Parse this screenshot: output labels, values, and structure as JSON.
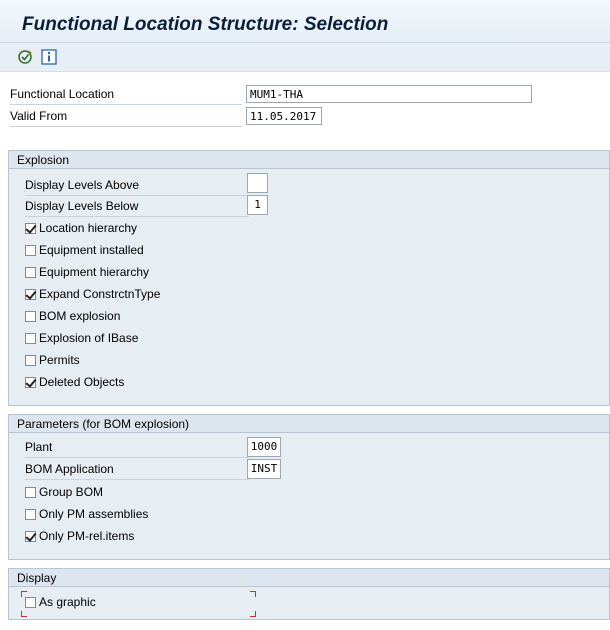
{
  "window": {
    "title": "Functional Location Structure: Selection"
  },
  "toolbar": {
    "execute_icon": "execute-icon",
    "info_icon": "info-icon"
  },
  "header_fields": {
    "functional_location": {
      "label": "Functional Location",
      "value": "MUM1-THA"
    },
    "valid_from": {
      "label": "Valid From",
      "value": "11.05.2017"
    }
  },
  "explosion": {
    "title": "Explosion",
    "display_levels_above": {
      "label": "Display Levels Above",
      "value": ""
    },
    "display_levels_below": {
      "label": "Display Levels Below",
      "value": "1"
    },
    "checkboxes": [
      {
        "label": "Location hierarchy",
        "checked": true
      },
      {
        "label": "Equipment installed",
        "checked": false
      },
      {
        "label": "Equipment hierarchy",
        "checked": false
      },
      {
        "label": "Expand ConstrctnType",
        "checked": true
      },
      {
        "label": "BOM explosion",
        "checked": false
      },
      {
        "label": "Explosion of IBase",
        "checked": false
      },
      {
        "label": "Permits",
        "checked": false
      },
      {
        "label": "Deleted Objects",
        "checked": true
      }
    ]
  },
  "bom_params": {
    "title": "Parameters (for BOM explosion)",
    "plant": {
      "label": "Plant",
      "value": "1000"
    },
    "bom_application": {
      "label": "BOM Application",
      "value": "INST"
    },
    "checkboxes": [
      {
        "label": "Group BOM",
        "checked": false
      },
      {
        "label": "Only PM assemblies",
        "checked": false
      },
      {
        "label": "Only PM-rel.items",
        "checked": true
      }
    ]
  },
  "display": {
    "title": "Display",
    "as_graphic": {
      "label": "As graphic",
      "checked": false
    }
  },
  "colors": {
    "group_bg": "#e6edf3",
    "title_text": "#0b1f3a",
    "focus_corners": "#d03020"
  }
}
